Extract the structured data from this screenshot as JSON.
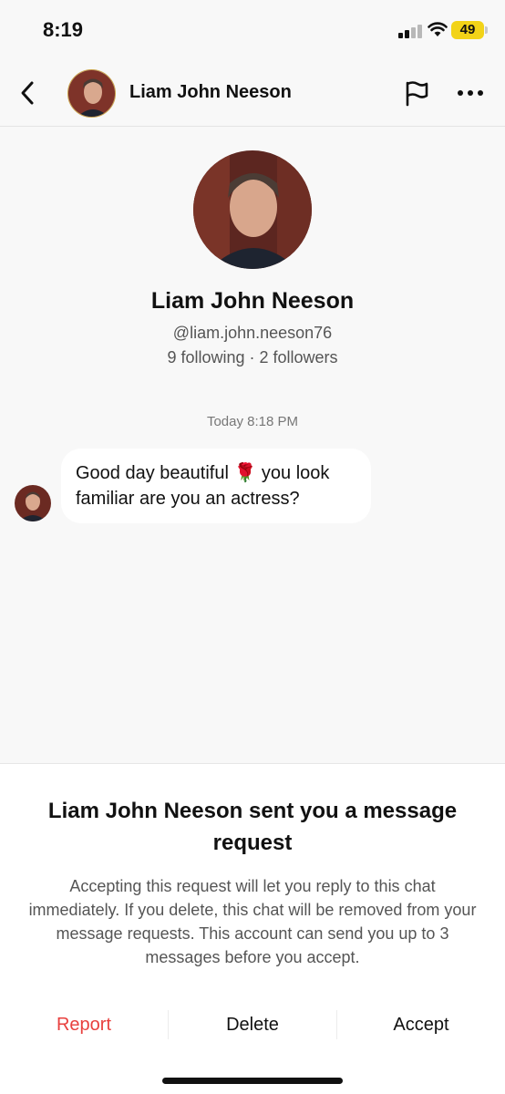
{
  "status_bar": {
    "time": "8:19",
    "battery": "49",
    "battery_color": "#f2d318"
  },
  "header": {
    "back_icon": "chevron-left-icon",
    "name": "Liam John Neeson",
    "flag_icon": "flag-icon",
    "more_icon": "more-horizontal-icon"
  },
  "profile": {
    "name": "Liam John Neeson",
    "handle": "@liam.john.neeson76",
    "stats": "9 following · 2 followers"
  },
  "chat": {
    "timestamp": "Today 8:18 PM",
    "messages": [
      {
        "text_before_emoji": "Good day beautiful ",
        "emoji": "🌹",
        "text_after_emoji": " you look familiar are you an actress?"
      }
    ]
  },
  "request_sheet": {
    "title": "Liam John Neeson sent you a message request",
    "body": "Accepting this request will let you reply to this chat immediately. If you delete, this chat will be removed from your message requests. This account can send you up to 3 messages before you accept.",
    "report_label": "Report",
    "delete_label": "Delete",
    "accept_label": "Accept",
    "report_color": "#e8403e"
  }
}
